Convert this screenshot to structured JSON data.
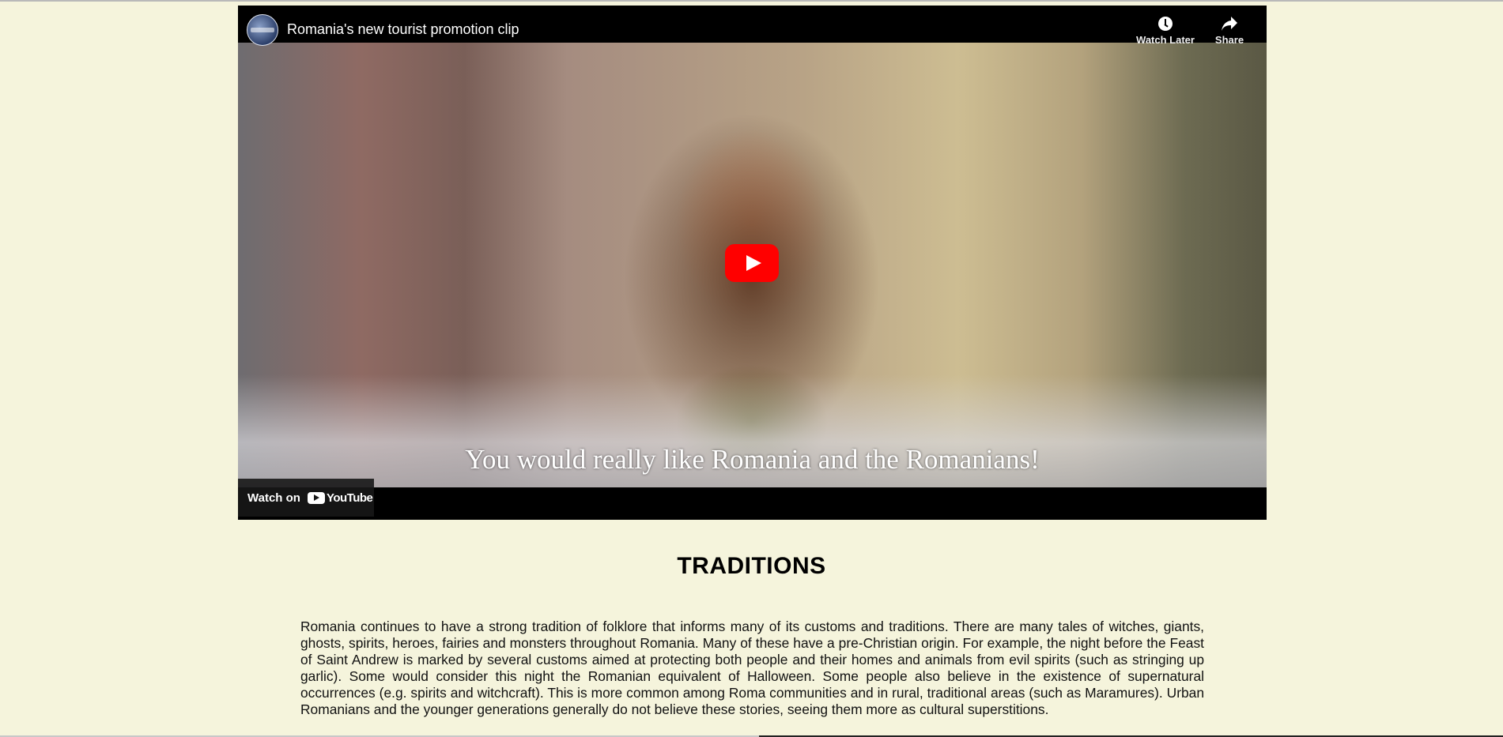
{
  "video": {
    "title": "Romania's new tourist promotion clip",
    "watch_later_label": "Watch Later",
    "share_label": "Share",
    "subtitle": "You would really like Romania and the Romanians!",
    "watch_on_label": "Watch on",
    "youtube_label": "YouTube",
    "play_color": "#ff0000"
  },
  "section": {
    "title": "TRADITIONS",
    "paragraph": "Romania continues to have a strong tradition of folklore that informs many of its customs and traditions. There are many tales of witches, giants, ghosts, spirits, heroes, fairies and monsters throughout Romania. Many of these have a pre-Christian origin. For example, the night before the Feast of Saint Andrew is marked by several customs aimed at protecting both people and their homes and animals from evil spirits (such as stringing up garlic). Some would consider this night the Romanian equivalent of Halloween. Some people also believe in the existence of supernatural occurrences (e.g. spirits and witchcraft). This is more common among Roma communities and in rural, traditional areas (such as Maramures). Urban Romanians and the younger generations generally do not believe these stories, seeing them more as cultural superstitions."
  },
  "colors": {
    "page_background": "#f5f4dc",
    "video_background": "#000000"
  }
}
